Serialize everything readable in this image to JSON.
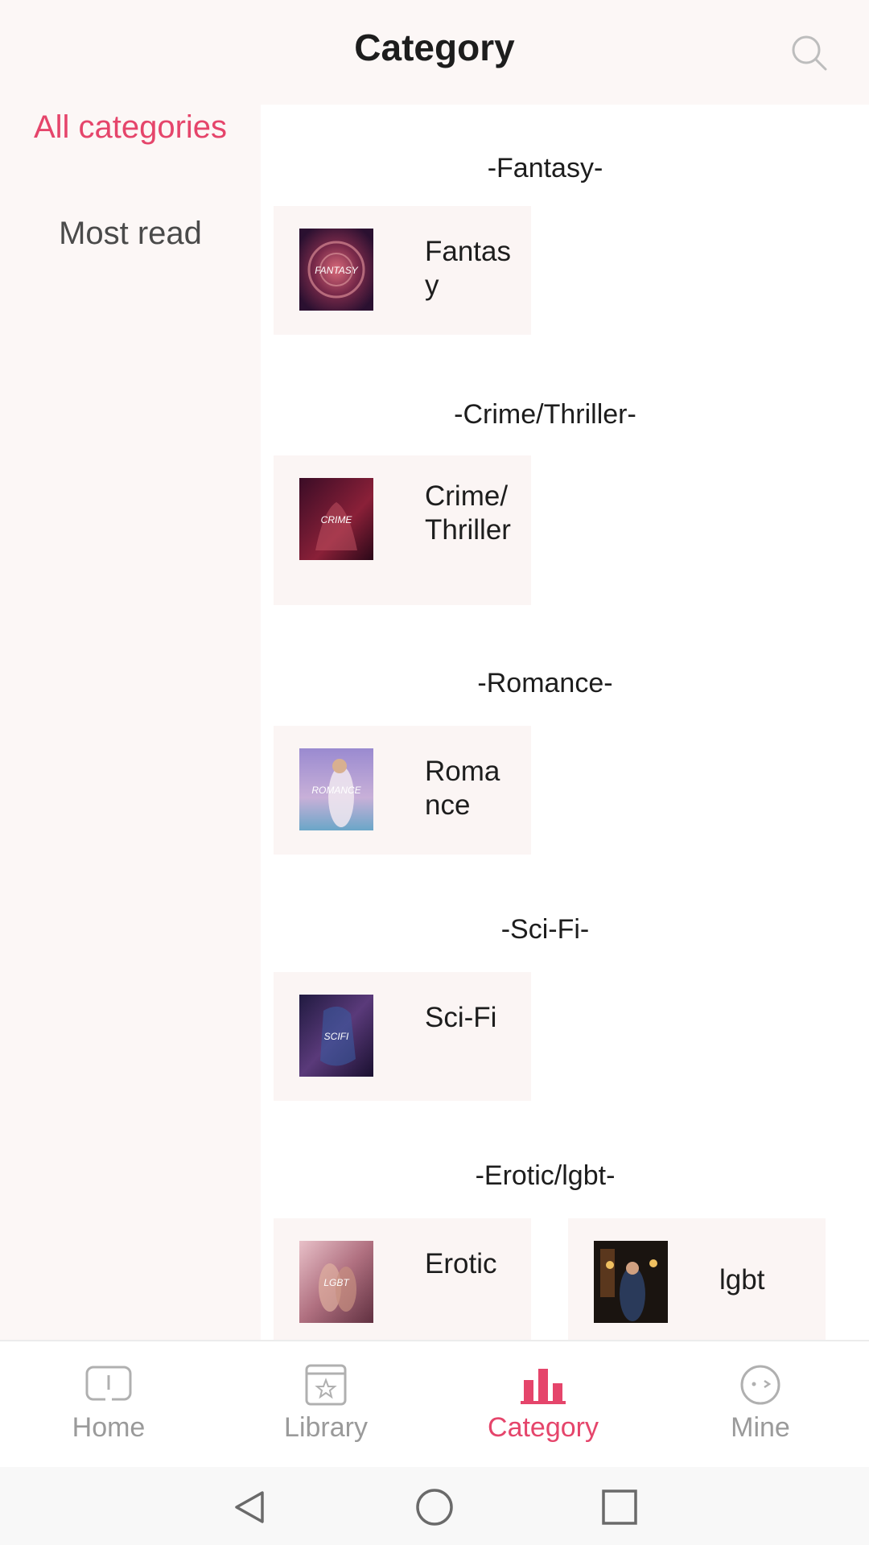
{
  "header": {
    "title": "Category"
  },
  "sidebar": {
    "items": [
      {
        "label": "All categories"
      },
      {
        "label": "Most read"
      }
    ]
  },
  "sections": [
    {
      "title": "-Fantasy-",
      "cards": [
        {
          "label": "Fantasy",
          "thumb_text": "FANTASY"
        }
      ]
    },
    {
      "title": "-Crime/Thriller-",
      "cards": [
        {
          "label": "Crime/Thriller",
          "thumb_text": "CRIME"
        }
      ]
    },
    {
      "title": "-Romance-",
      "cards": [
        {
          "label": "Romance",
          "thumb_text": "ROMANCE"
        }
      ]
    },
    {
      "title": "-Sci-Fi-",
      "cards": [
        {
          "label": "Sci-Fi",
          "thumb_text": "SCIFI"
        }
      ]
    },
    {
      "title": "-Erotic/lgbt-",
      "cards": [
        {
          "label": "Erotic",
          "thumb_text": "LGBT"
        },
        {
          "label": "lgbt",
          "thumb_text": ""
        }
      ]
    }
  ],
  "bottom_nav": {
    "items": [
      {
        "label": "Home",
        "icon": "book-icon"
      },
      {
        "label": "Library",
        "icon": "star-book-icon"
      },
      {
        "label": "Category",
        "icon": "bar-chart-icon"
      },
      {
        "label": "Mine",
        "icon": "face-icon"
      }
    ]
  },
  "system_nav": {
    "icons": [
      "back-triangle-icon",
      "home-circle-icon",
      "recents-square-icon"
    ]
  },
  "colors": {
    "accent": "#e5456b",
    "sidebar_bg": "#fcf7f6",
    "card_bg": "#fbf5f4",
    "inactive": "#9a9a9a"
  }
}
